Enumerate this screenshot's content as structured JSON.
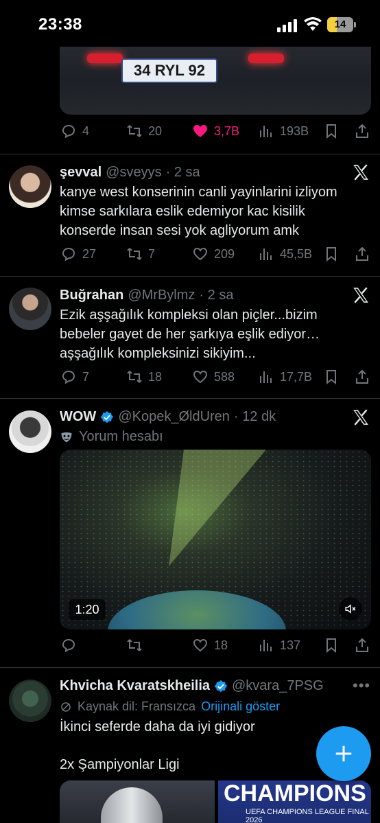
{
  "status_bar": {
    "time": "23:38",
    "battery": "14"
  },
  "tweet_top": {
    "plate_text": "34 RYL 92",
    "replies": "4",
    "retweets": "20",
    "likes": "3,7B",
    "views": "193B"
  },
  "tweets": [
    {
      "name": "şevval",
      "handle": "@sveyys",
      "time": "· 2 sa",
      "text": "kanye west konserinin canli yayinlarini izliyom kimse sarkılara eslik edemiyor kac kisilik konserde insan sesi yok agliyorum amk",
      "replies": "27",
      "retweets": "7",
      "likes": "209",
      "views": "45,5B"
    },
    {
      "name": "Buğrahan",
      "handle": "@MrBylmz",
      "time": "· 2 sa",
      "text": "Ezik aşşağılık kompleksi olan piçler...bizim bebeler gayet de her şarkıya eşlik ediyor… aşşağılık kompleksinizi sikiyim...",
      "replies": "7",
      "retweets": "18",
      "likes": "588",
      "views": "17,7B"
    },
    {
      "name": "WOW",
      "handle": "@Kopek_ØldUren",
      "time": "· 12 dk",
      "subtitle": "Yorum hesabı",
      "video_time": "1:20",
      "replies": "",
      "retweets": "",
      "likes": "18",
      "views": "137"
    },
    {
      "name": "Khvicha Kvaratskheilia",
      "handle": "@kvara_7PSG",
      "source_lang": "Kaynak dil: Fransızca",
      "show_original": "Orijinali göster",
      "text_line1": "İkinci seferde daha da iyi gidiyor",
      "text_line2": "2x Şampiyonlar Ligi",
      "image_text": "CHAMPIONS",
      "image_sub": "UEFA CHAMPIONS LEAGUE FINAL 2026"
    }
  ],
  "colors": {
    "accent": "#1d9bf0",
    "like": "#f91880",
    "muted": "#71767b",
    "bg": "#000000"
  },
  "icons": [
    "reply-icon",
    "retweet-icon",
    "like-icon",
    "views-icon",
    "bookmark-icon",
    "share-icon",
    "x-logo-icon",
    "verified-icon",
    "compose-plus-icon"
  ]
}
